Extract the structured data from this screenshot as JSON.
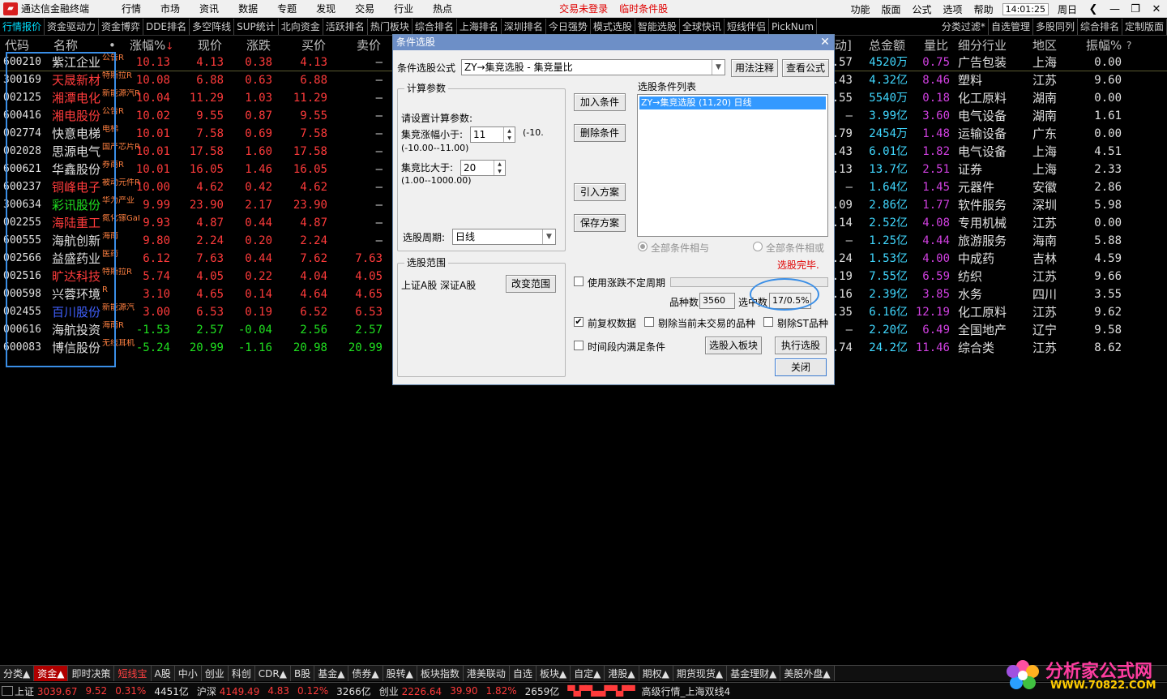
{
  "topbar": {
    "app_title": "通达信金融终端",
    "menu": [
      "行情",
      "市场",
      "资讯",
      "数据",
      "专题",
      "发现",
      "交易",
      "行业",
      "热点"
    ],
    "alert_login": "交易未登录",
    "alert_cond": "临时条件股",
    "right_menu": [
      "功能",
      "版面",
      "公式",
      "选项",
      "帮助"
    ],
    "clock": "14:01:25",
    "weekday": "周日"
  },
  "tabs": [
    "行情报价",
    "资金驱动力",
    "资金博弈",
    "DDE排名",
    "多空阵线",
    "SUP统计",
    "北向资金",
    "活跃排名",
    "热门板块",
    "综合排名",
    "上海排名",
    "深圳排名",
    "今日强势",
    "模式选股",
    "智能选股",
    "全球快讯",
    "短线伴侣",
    "PickNum"
  ],
  "right_tabs": [
    "分类过滤*",
    "自选管理",
    "多股同列",
    "综合排名",
    "定制版面"
  ],
  "table": {
    "headers": {
      "code": "代码",
      "name": "名称",
      "dot": "•",
      "pct": "涨幅%",
      "price": "现价",
      "chg": "涨跌",
      "bid": "买价",
      "ask": "卖价",
      "ratio": "动]",
      "amount": "总金额",
      "volratio": "量比",
      "industry": "细分行业",
      "region": "地区",
      "amp": "振幅%",
      "q": "?"
    },
    "rows": [
      {
        "code": "600210",
        "name": "紫江企业",
        "tag": "公告R",
        "pct": "10.13",
        "price": "4.13",
        "chg": "0.38",
        "bid": "4.13",
        "ask": "—",
        "ratio": ".57",
        "amount": "4520万",
        "volratio": "0.75",
        "industry": "广告包装",
        "region": "上海",
        "amp": "0.00",
        "nc": "white",
        "pc": "red",
        "ac": "cyan"
      },
      {
        "code": "300169",
        "name": "天晟新材",
        "tag": "特斯拉R",
        "pct": "10.08",
        "price": "6.88",
        "chg": "0.63",
        "bid": "6.88",
        "ask": "—",
        "ratio": ".43",
        "amount": "4.32亿",
        "volratio": "8.46",
        "industry": "塑料",
        "region": "江苏",
        "amp": "9.60",
        "nc": "red",
        "pc": "red",
        "ac": "cyan"
      },
      {
        "code": "002125",
        "name": "湘潭电化",
        "tag": "新能源汽R",
        "pct": "10.04",
        "price": "11.29",
        "chg": "1.03",
        "bid": "11.29",
        "ask": "—",
        "ratio": ".55",
        "amount": "5540万",
        "volratio": "0.18",
        "industry": "化工原料",
        "region": "湖南",
        "amp": "0.00",
        "nc": "red",
        "pc": "red",
        "ac": "cyan"
      },
      {
        "code": "600416",
        "name": "湘电股份",
        "tag": "公告R",
        "pct": "10.02",
        "price": "9.55",
        "chg": "0.87",
        "bid": "9.55",
        "ask": "—",
        "ratio": "—",
        "amount": "3.99亿",
        "volratio": "3.60",
        "industry": "电气设备",
        "region": "湖南",
        "amp": "1.61",
        "nc": "red",
        "pc": "red",
        "ac": "cyan"
      },
      {
        "code": "002774",
        "name": "快意电梯",
        "tag": "电梯",
        "pct": "10.01",
        "price": "7.58",
        "chg": "0.69",
        "bid": "7.58",
        "ask": "—",
        "ratio": ".79",
        "amount": "2454万",
        "volratio": "1.48",
        "industry": "运输设备",
        "region": "广东",
        "amp": "0.00",
        "nc": "white",
        "pc": "red",
        "ac": "cyan"
      },
      {
        "code": "002028",
        "name": "思源电气",
        "tag": "国产芯片R",
        "pct": "10.01",
        "price": "17.58",
        "chg": "1.60",
        "bid": "17.58",
        "ask": "—",
        "ratio": ".43",
        "amount": "6.01亿",
        "volratio": "1.82",
        "industry": "电气设备",
        "region": "上海",
        "amp": "4.51",
        "nc": "white",
        "pc": "red",
        "ac": "cyan"
      },
      {
        "code": "600621",
        "name": "华鑫股份",
        "tag": "券商R",
        "pct": "10.01",
        "price": "16.05",
        "chg": "1.46",
        "bid": "16.05",
        "ask": "—",
        "ratio": ".13",
        "amount": "13.7亿",
        "volratio": "2.51",
        "industry": "证券",
        "region": "上海",
        "amp": "2.33",
        "nc": "white",
        "pc": "red",
        "ac": "cyan"
      },
      {
        "code": "600237",
        "name": "铜峰电子",
        "tag": "被动元件R",
        "pct": "10.00",
        "price": "4.62",
        "chg": "0.42",
        "bid": "4.62",
        "ask": "—",
        "ratio": "—",
        "amount": "1.64亿",
        "volratio": "1.45",
        "industry": "元器件",
        "region": "安徽",
        "amp": "2.86",
        "nc": "red",
        "pc": "red",
        "ac": "cyan"
      },
      {
        "code": "300634",
        "name": "彩讯股份",
        "tag": "华为产业",
        "pct": "9.99",
        "price": "23.90",
        "chg": "2.17",
        "bid": "23.90",
        "ask": "—",
        "ratio": ".09",
        "amount": "2.86亿",
        "volratio": "1.77",
        "industry": "软件服务",
        "region": "深圳",
        "amp": "5.98",
        "nc": "green",
        "pc": "red",
        "ac": "cyan"
      },
      {
        "code": "002255",
        "name": "海陆重工",
        "tag": "氮化镓GaR",
        "pct": "9.93",
        "price": "4.87",
        "chg": "0.44",
        "bid": "4.87",
        "ask": "—",
        "ratio": ".14",
        "amount": "2.52亿",
        "volratio": "4.08",
        "industry": "专用机械",
        "region": "江苏",
        "amp": "0.00",
        "nc": "red",
        "pc": "red",
        "ac": "cyan"
      },
      {
        "code": "600555",
        "name": "海航创新",
        "tag": "海南",
        "pct": "9.80",
        "price": "2.24",
        "chg": "0.20",
        "bid": "2.24",
        "ask": "—",
        "ratio": "—",
        "amount": "1.25亿",
        "volratio": "4.44",
        "industry": "旅游服务",
        "region": "海南",
        "amp": "5.88",
        "nc": "white",
        "pc": "red",
        "ac": "cyan"
      },
      {
        "code": "002566",
        "name": "益盛药业",
        "tag": "医药",
        "pct": "6.12",
        "price": "7.63",
        "chg": "0.44",
        "bid": "7.62",
        "ask": "7.63",
        "ratio": ".24",
        "amount": "1.53亿",
        "volratio": "4.00",
        "industry": "中成药",
        "region": "吉林",
        "amp": "4.59",
        "nc": "white",
        "pc": "red",
        "ac": "cyan"
      },
      {
        "code": "002516",
        "name": "旷达科技",
        "tag": "特斯拉R",
        "pct": "5.74",
        "price": "4.05",
        "chg": "0.22",
        "bid": "4.04",
        "ask": "4.05",
        "ratio": ".19",
        "amount": "7.55亿",
        "volratio": "6.59",
        "industry": "纺织",
        "region": "江苏",
        "amp": "9.66",
        "nc": "red",
        "pc": "red",
        "ac": "cyan"
      },
      {
        "code": "000598",
        "name": "兴蓉环境",
        "tag": "R",
        "pct": "3.10",
        "price": "4.65",
        "chg": "0.14",
        "bid": "4.64",
        "ask": "4.65",
        "ratio": ".16",
        "amount": "2.39亿",
        "volratio": "3.85",
        "industry": "水务",
        "region": "四川",
        "amp": "3.55",
        "nc": "white",
        "pc": "red",
        "ac": "cyan"
      },
      {
        "code": "002455",
        "name": "百川股份",
        "tag": "新能源汽",
        "pct": "3.00",
        "price": "6.53",
        "chg": "0.19",
        "bid": "6.52",
        "ask": "6.53",
        "ratio": ".35",
        "amount": "6.16亿",
        "volratio": "12.19",
        "industry": "化工原料",
        "region": "江苏",
        "amp": "9.62",
        "nc": "blue",
        "pc": "red",
        "ac": "cyan"
      },
      {
        "code": "000616",
        "name": "海航投资",
        "tag": "海南R",
        "pct": "-1.53",
        "price": "2.57",
        "chg": "-0.04",
        "bid": "2.56",
        "ask": "2.57",
        "ratio": "—",
        "amount": "2.20亿",
        "volratio": "6.49",
        "industry": "全国地产",
        "region": "辽宁",
        "amp": "9.58",
        "nc": "white",
        "pc": "green",
        "ac": "cyan"
      },
      {
        "code": "600083",
        "name": "博信股份",
        "tag": "无线耳机",
        "pct": "-5.24",
        "price": "20.99",
        "chg": "-1.16",
        "bid": "20.98",
        "ask": "20.99",
        "ratio": ".74",
        "amount": "24.2亿",
        "volratio": "11.46",
        "industry": "综合类",
        "region": "江苏",
        "amp": "8.62",
        "nc": "white",
        "pc": "green",
        "ac": "cyan"
      }
    ]
  },
  "dialog": {
    "title": "条件选股",
    "formula_label": "条件选股公式",
    "formula_value": "ZY→集竞选股 - 集竞量比",
    "btn_usage": "用法注释",
    "btn_view": "查看公式",
    "calc_group": "计算参数",
    "calc_prompt": "请设置计算参数:",
    "param1_label": "集竞涨幅小于:",
    "param1_value": "11",
    "param1_range": "(-10.00--11.00)",
    "param2_label": "集竞比大于:",
    "param2_value": "20",
    "param2_range": "(1.00--1000.00)",
    "period_label": "选股周期:",
    "period_value": "日线",
    "btn_add": "加入条件",
    "btn_delete": "删除条件",
    "btn_import": "引入方案",
    "btn_save": "保存方案",
    "cond_list_label": "选股条件列表",
    "cond_list": [
      "ZY→集竞选股 (11,20) 日线"
    ],
    "radio_and": "全部条件相与",
    "radio_or": "全部条件相或",
    "status": "选股完毕.",
    "scope_group": "选股范围",
    "scope_value": "上证A股 深证A股",
    "btn_change_scope": "改变范围",
    "chk_uncertain": "使用涨跌不定周期",
    "count_label": "品种数",
    "count_value": "3560",
    "selected_label": "选中数",
    "selected_value": "17/0.5%",
    "chk_adjust": "前复权数据",
    "chk_exclude_halt": "剔除当前未交易的品种",
    "chk_exclude_st": "剔除ST品种",
    "chk_time": "时间段内满足条件",
    "btn_to_block": "选股入板块",
    "btn_execute": "执行选股",
    "btn_close": "关闭"
  },
  "bottom_tabs": [
    "分类▲",
    "资金▲",
    "即时决策",
    "短线宝",
    "A股",
    "中小",
    "创业",
    "科创",
    "CDR▲",
    "B股",
    "基金▲",
    "债券▲",
    "股转▲",
    "板块指数",
    "港美联动",
    "自选",
    "板块▲",
    "自定▲",
    "港股▲",
    "期权▲",
    "期货现货▲",
    "基金理财▲",
    "美股外盘▲"
  ],
  "status": {
    "sh_label": "上证",
    "sh_val": "3039.67",
    "sh_chg": "9.52",
    "sh_pct": "0.31%",
    "sh_amt": "4451亿",
    "hs_label": "沪深",
    "hs_val": "4149.49",
    "hs_chg": "4.83",
    "hs_pct": "0.12%",
    "hs_amt": "3266亿",
    "cy_label": "创业",
    "cy_val": "2226.64",
    "cy_chg": "39.90",
    "cy_pct": "1.82%",
    "cy_amt": "2659亿",
    "server": "高级行情_上海双线4"
  },
  "watermark": {
    "text": "分析家公式网",
    "url": "WWW.70822.COM"
  },
  "colors": {
    "up": "#ff3b3b",
    "down": "#20e020",
    "accent_blue": "#3a8ee6",
    "dialog_title": "#6d8fc7"
  }
}
